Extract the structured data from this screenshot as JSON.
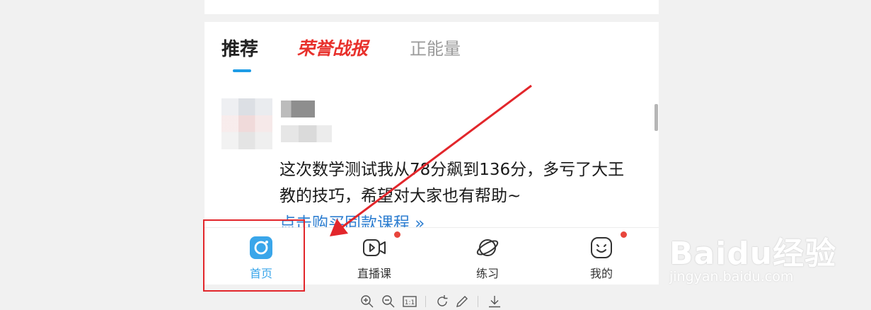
{
  "tabs": [
    {
      "label": "推荐",
      "active": true
    },
    {
      "label": "荣誉战报",
      "active": false
    },
    {
      "label": "正能量",
      "active": false
    }
  ],
  "post": {
    "text": "这次数学测试我从78分飙到136分，多亏了大王教的技巧，希望对大家也有帮助~",
    "link": "点击购买同款课程 »"
  },
  "bottom_nav": [
    {
      "label": "首页",
      "icon": "home-camera-icon",
      "active": true
    },
    {
      "label": "直播课",
      "icon": "live-video-icon",
      "badge": true
    },
    {
      "label": "练习",
      "icon": "planet-icon"
    },
    {
      "label": "我的",
      "icon": "smiley-face-icon",
      "badge": true
    }
  ],
  "toolbar": [
    "zoom-in-icon",
    "zoom-out-icon",
    "actual-size-icon",
    "rotate-icon",
    "edit-icon",
    "download-icon"
  ],
  "toolbar_labels": {
    "actual_size": "1:1"
  },
  "watermark": {
    "brand": "Baidu经验",
    "url": "jingyan.baidu.com"
  },
  "colors": {
    "accent": "#1e9ce6",
    "honor_red": "#e8312c",
    "annotation_red": "#e2262b",
    "badge_red": "#e8453c"
  }
}
